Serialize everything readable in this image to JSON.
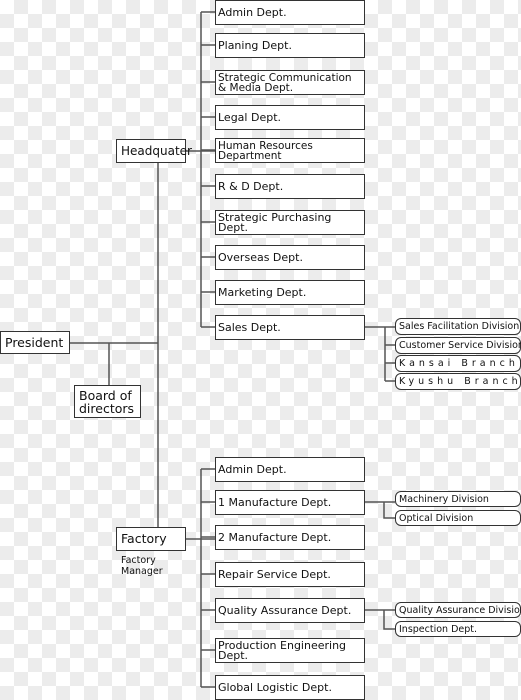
{
  "president": "President",
  "board": "Board of directors",
  "headquater": "Headquater",
  "factory": "Factory",
  "factory_note": "Factory Manager",
  "hq_depts": [
    "Admin Dept.",
    "Planing Dept.",
    "Strategic Communication & Media Dept.",
    "Legal Dept.",
    "Human Resources Department",
    "R & D Dept.",
    "Strategic Purchasing Dept.",
    "Overseas Dept.",
    "Marketing Dept.",
    "Sales Dept."
  ],
  "sales_subs": [
    "Sales Facilitation Division",
    "Customer Service Division",
    "Kansai Branch",
    "Kyushu Branch"
  ],
  "factory_depts": [
    "Admin Dept.",
    "1 Manufacture Dept.",
    "2 Manufacture Dept.",
    "Repair Service Dept.",
    "Quality Assurance Dept.",
    "Production Engineering Dept.",
    "Global Logistic Dept."
  ],
  "manufacture1_subs": [
    "Machinery Division",
    "Optical Division"
  ],
  "qa_subs": [
    "Quality Assurance Division",
    "Inspection Dept."
  ]
}
